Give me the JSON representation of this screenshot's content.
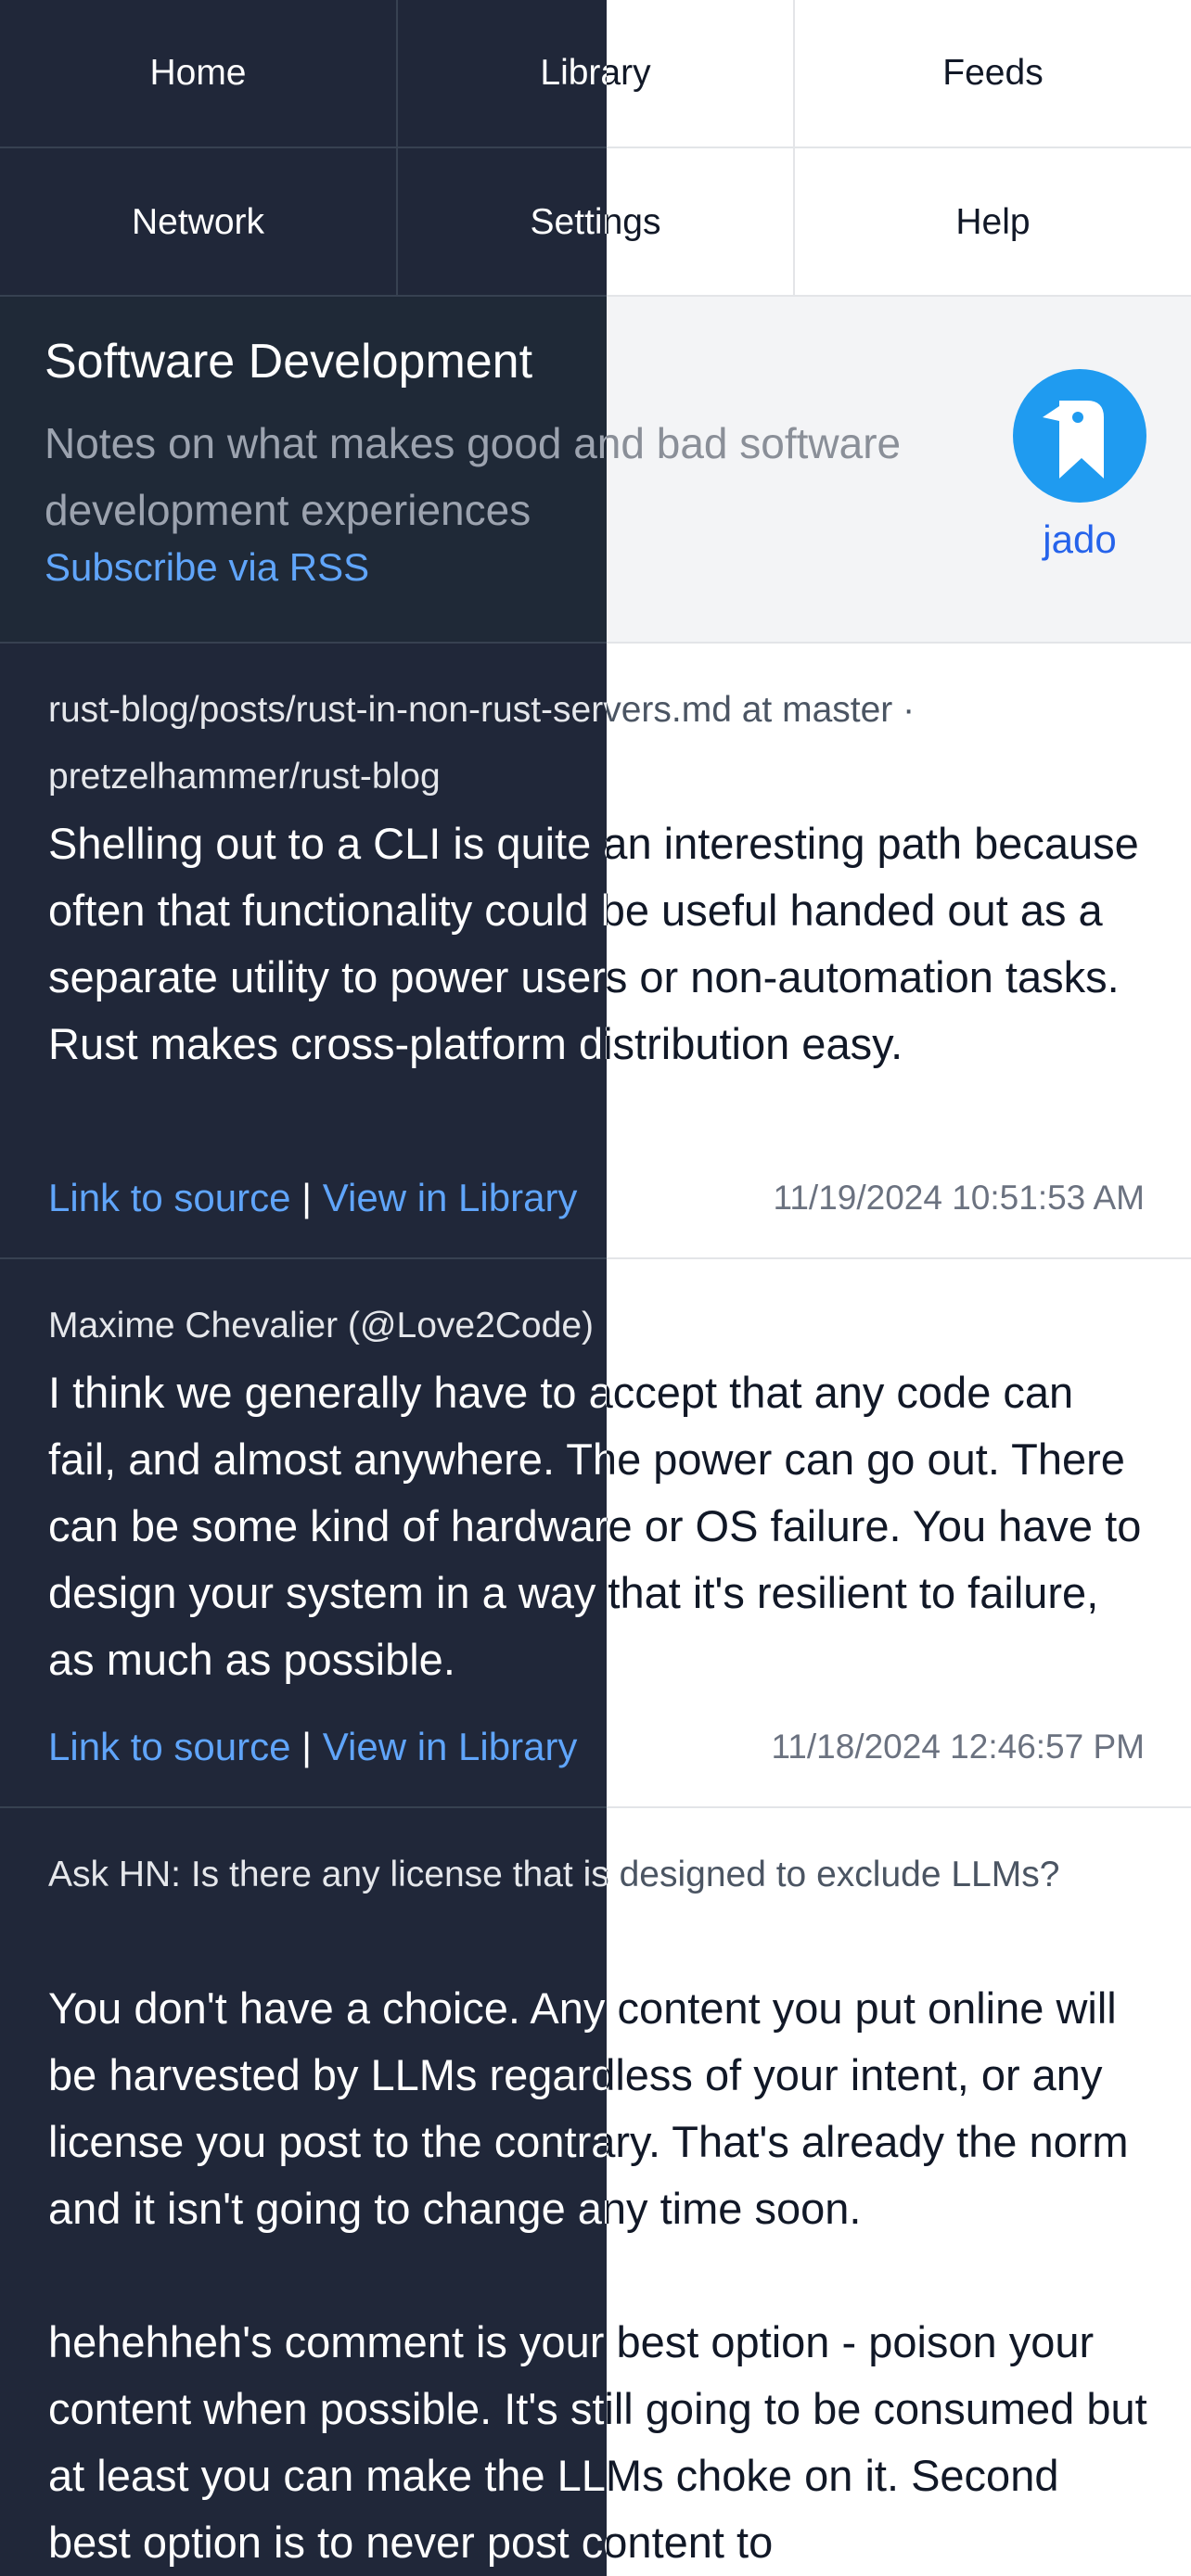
{
  "nav": {
    "items": [
      "Home",
      "Library",
      "Feeds",
      "Network",
      "Settings",
      "Help"
    ]
  },
  "header": {
    "title": "Software Development",
    "description": "Notes on what makes good and bad software development experiences",
    "rss_label": "Subscribe via RSS",
    "author": "jado",
    "avatar_icon": "bird-logo-icon"
  },
  "posts": [
    {
      "title": "rust-blog/posts/rust-in-non-rust-servers.md at master · pretzelhammer/rust-blog",
      "body": "Shelling out to a CLI is quite an interesting path because often that functionality could be useful handed out as a separate utility to power users or non-automation tasks. Rust makes cross-platform distribution easy.",
      "link_source": "Link to source",
      "separator": "|",
      "link_library": "View in Library",
      "date": "11/19/2024 10:51:53 AM"
    },
    {
      "title": "Maxime Chevalier (@Love2Code)",
      "body": "I think we generally have to accept that any code can fail, and almost anywhere. The power can go out. There can be some kind of hardware or OS failure. You have to design your system in a way that it's resilient to failure, as much as possible.",
      "link_source": "Link to source",
      "separator": "|",
      "link_library": "View in Library",
      "date": "11/18/2024 12:46:57 PM"
    },
    {
      "title": "Ask HN: Is there any license that is designed to exclude LLMs?",
      "body": "You don't have a choice. Any content you put online will be harvested by LLMs regardless of your intent, or any license you post to the contrary. That's already the norm and it isn't going to change any time soon.\n\nhehehheh's comment is your best option - poison your content when possible. It's still going to be consumed but at least you can make the LLMs choke on it. Second best option is to never post content to"
    }
  ],
  "colors": {
    "overlay": "#0f172a",
    "link": "#2f74d8",
    "avatar": "#1f9bf0"
  }
}
